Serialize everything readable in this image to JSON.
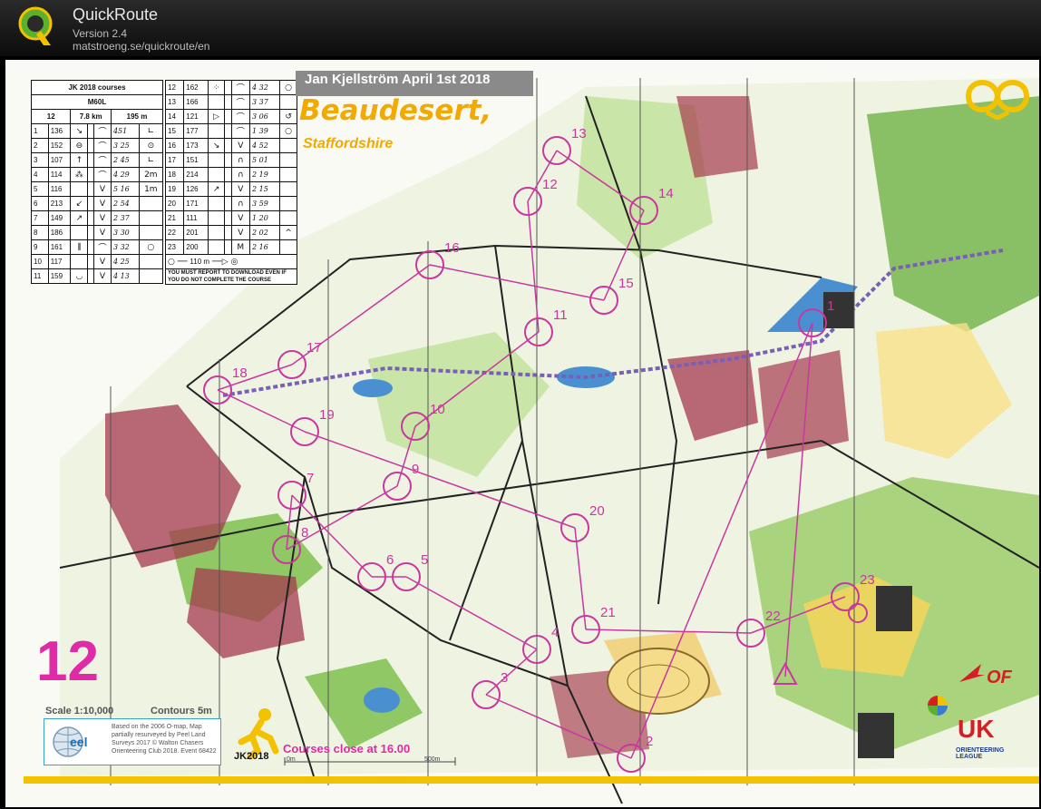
{
  "app": {
    "name": "QuickRoute",
    "version": "Version 2.4",
    "url": "matstroeng.se/quickroute/en"
  },
  "map": {
    "event_title": "Jan Kjellström April 1st 2018",
    "map_name": "Beaudesert,",
    "county": "Staffordshire",
    "course_number": "12",
    "scale": "Scale 1:10,000",
    "contours": "Contours 5m",
    "credit": "Based on the 2006 O-map, Map partially resurveyed by Peel Land Surveys 2017 © Walton Chasers Orienteering Club 2018. Event 68422",
    "courses_close": "Courses close at 16.00",
    "jk_logo_text": "JK2018",
    "bof_text": "OF",
    "uk_text": "UK",
    "uk_sub": "ORIENTEERING LEAGUE",
    "scale_bar": {
      "start": "0m",
      "end": "500m"
    }
  },
  "control_card": {
    "header": "JK 2018 courses",
    "class": "M60L",
    "course": "12",
    "length": "7.8 km",
    "climb": "195 m",
    "rows_left": [
      {
        "n": "1",
        "code": "136",
        "s1": "↘",
        "s2": "",
        "s3": "⌒",
        "s4": "∟",
        "hand": "451"
      },
      {
        "n": "2",
        "code": "152",
        "s1": "⊖",
        "s2": "",
        "s3": "⌒",
        "s4": "⊙",
        "hand": "3 25"
      },
      {
        "n": "3",
        "code": "107",
        "s1": "↑",
        "s2": "",
        "s3": "⌒",
        "s4": "∟",
        "hand": "2 45"
      },
      {
        "n": "4",
        "code": "114",
        "s1": "⁂",
        "s2": "",
        "s3": "⌒",
        "s4": "2m",
        "hand": "4 29"
      },
      {
        "n": "5",
        "code": "116",
        "s1": "",
        "s2": "",
        "s3": "V",
        "s4": "1m",
        "hand": "5 16"
      },
      {
        "n": "6",
        "code": "213",
        "s1": "↙",
        "s2": "",
        "s3": "V",
        "s4": "",
        "hand": "2 54"
      },
      {
        "n": "7",
        "code": "149",
        "s1": "↗",
        "s2": "",
        "s3": "V",
        "s4": "",
        "hand": "2 37"
      },
      {
        "n": "8",
        "code": "186",
        "s1": "",
        "s2": "",
        "s3": "V",
        "s4": "",
        "hand": "3 30"
      },
      {
        "n": "9",
        "code": "161",
        "s1": "⫼",
        "s2": "",
        "s3": "⌒",
        "s4": "○",
        "hand": "3 32"
      },
      {
        "n": "10",
        "code": "117",
        "s1": "",
        "s2": "",
        "s3": "V",
        "s4": "",
        "hand": "4 25"
      },
      {
        "n": "11",
        "code": "159",
        "s1": "◡",
        "s2": "",
        "s3": "V",
        "s4": "",
        "hand": "4 13"
      }
    ],
    "rows_right": [
      {
        "n": "12",
        "code": "162",
        "s1": "⁘",
        "s2": "",
        "s3": "⌒",
        "s4": "○",
        "hand": "4 32"
      },
      {
        "n": "13",
        "code": "166",
        "s1": "",
        "s2": "",
        "s3": "⌒",
        "s4": "",
        "hand": "3 37"
      },
      {
        "n": "14",
        "code": "121",
        "s1": "▷",
        "s2": "",
        "s3": "⌒",
        "s4": "↺",
        "hand": "3 06"
      },
      {
        "n": "15",
        "code": "177",
        "s1": "",
        "s2": "",
        "s3": "⌒",
        "s4": "○",
        "hand": "1 39"
      },
      {
        "n": "16",
        "code": "173",
        "s1": "↘",
        "s2": "",
        "s3": "V",
        "s4": "",
        "hand": "4 52"
      },
      {
        "n": "17",
        "code": "151",
        "s1": "",
        "s2": "",
        "s3": "∩",
        "s4": "",
        "hand": "5 01"
      },
      {
        "n": "18",
        "code": "214",
        "s1": "",
        "s2": "",
        "s3": "∩",
        "s4": "",
        "hand": "2 19"
      },
      {
        "n": "19",
        "code": "126",
        "s1": "↗",
        "s2": "",
        "s3": "V",
        "s4": "",
        "hand": "2 15"
      },
      {
        "n": "20",
        "code": "171",
        "s1": "",
        "s2": "",
        "s3": "∩",
        "s4": "",
        "hand": "3 59"
      },
      {
        "n": "21",
        "code": "111",
        "s1": "",
        "s2": "",
        "s3": "V",
        "s4": "",
        "hand": "1 20"
      },
      {
        "n": "22",
        "code": "201",
        "s1": "",
        "s2": "",
        "s3": "V",
        "s4": "^",
        "hand": "2 02"
      },
      {
        "n": "23",
        "code": "200",
        "s1": "",
        "s2": "",
        "s3": "M",
        "s4": "",
        "hand": "2 16"
      }
    ],
    "finish_length": "110 m",
    "note": "YOU MUST REPORT TO DOWNLOAD EVEN IF YOU DO NOT COMPLETE THE COURSE"
  },
  "controls": [
    "1",
    "2",
    "3",
    "4",
    "5",
    "6",
    "7",
    "8",
    "9",
    "10",
    "11",
    "12",
    "13",
    "14",
    "15",
    "16",
    "17",
    "18",
    "19",
    "20",
    "21",
    "22",
    "23"
  ],
  "colors": {
    "course": "#c9379f",
    "vegetation_green": "#7ec04e",
    "open_land": "#f6d55c",
    "water": "#4a90d0",
    "out_of_bounds": "#a63a4f"
  }
}
